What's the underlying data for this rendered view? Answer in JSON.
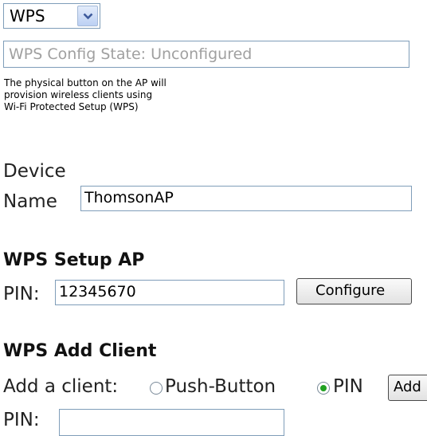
{
  "mode_select": {
    "value": "WPS",
    "arrow_icon": "chevron-down-icon"
  },
  "config_state": {
    "text": "WPS Config State: Unconfigured"
  },
  "description": {
    "line1": "The physical button on the AP will",
    "line2": "provision wireless clients using",
    "line3": "Wi-Fi Protected Setup (WPS)"
  },
  "device_name": {
    "label_line1": "Device",
    "label_line2": "Name",
    "value": "ThomsonAP"
  },
  "setup_ap": {
    "heading": "WPS Setup AP",
    "pin_label": "PIN:",
    "pin_value": "12345670",
    "configure_label": "Configure"
  },
  "add_client": {
    "heading": "WPS Add Client",
    "prompt": "Add a client:",
    "options": [
      {
        "label": "Push-Button",
        "checked": false
      },
      {
        "label": "PIN",
        "checked": true
      }
    ],
    "add_label": "Add",
    "pin_label": "PIN:",
    "pin_value": ""
  },
  "colors": {
    "input_border": "#7f9db9",
    "placeholder_text": "#a0a0a0",
    "radio_selected": "#21a121"
  }
}
